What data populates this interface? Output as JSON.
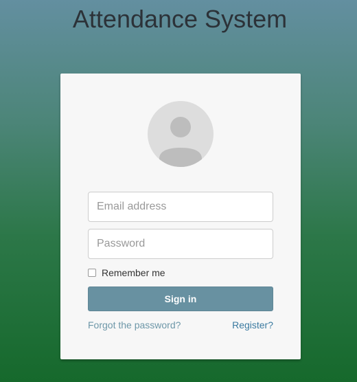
{
  "header": {
    "title": "Attendance System"
  },
  "login_form": {
    "avatar_icon": "user-avatar-icon",
    "email": {
      "value": "",
      "placeholder": "Email address"
    },
    "password": {
      "value": "",
      "placeholder": "Password"
    },
    "remember_label": "Remember me",
    "remember_checked": false,
    "signin_label": "Sign in",
    "forgot_label": "Forgot the password?",
    "register_label": "Register?"
  },
  "colors": {
    "background_top": "#638fa0",
    "background_bottom": "#16692c",
    "card_background": "#f7f7f7",
    "button": "#6891a1",
    "link_forgot": "#6d97a8",
    "link_register": "#3a7aa0"
  }
}
